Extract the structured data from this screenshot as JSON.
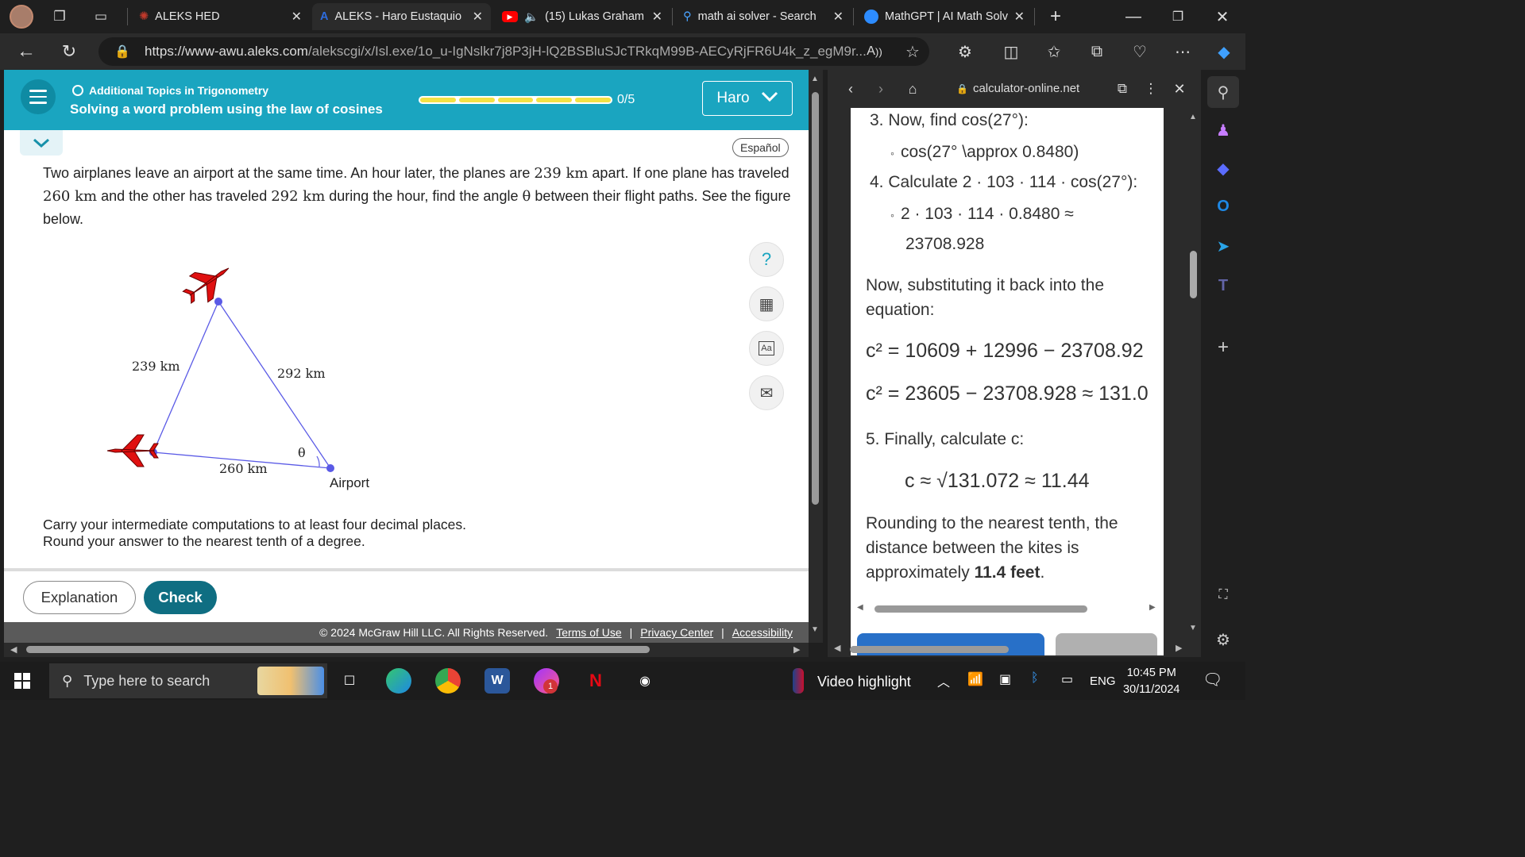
{
  "browser": {
    "tabs": [
      {
        "title": "ALEKS HED",
        "active": false
      },
      {
        "title": "ALEKS - Haro Eustaquio",
        "active": true
      },
      {
        "title": "(15) Lukas Graham",
        "active": false
      },
      {
        "title": "math ai solver - Search",
        "active": false
      },
      {
        "title": "MathGPT | AI Math Solv",
        "active": false
      }
    ],
    "url_host": "https://www-awu.aleks.com",
    "url_path": "/alekscgi/x/Isl.exe/1o_u-IgNslkr7j8P3jH-lQ2BSBluSJcTRkqM99B-AECyRjFR6U4k_z_egM9r..."
  },
  "aleks": {
    "topic": "Additional Topics in Trigonometry",
    "lesson": "Solving a word problem using the law of cosines",
    "progress": "0/5",
    "progress_fraction": 0.0,
    "user": "Haro",
    "espanol": "Español",
    "problem": {
      "p1": "Two airplanes leave an airport at the same time. An hour later, the planes are ",
      "d1": "239 km",
      "p2": " apart. If one plane has traveled\n",
      "d2": "260 km",
      "p3": " and the other has traveled ",
      "d3": "292 km",
      "p4": " during the hour, find the angle ",
      "theta": "θ",
      "p5": " between their flight paths. See the figure\nbelow."
    },
    "diagram": {
      "label_left": "239 km",
      "label_right": "292 km",
      "label_bottom": "260 km",
      "label_angle": "θ",
      "label_airport": "Airport"
    },
    "instructions": "Carry your intermediate computations to at least four decimal places.\nRound your answer to the nearest tenth of a degree.",
    "explanation_btn": "Explanation",
    "check_btn": "Check",
    "footer": {
      "copyright": "© 2024 McGraw Hill LLC. All Rights Reserved.",
      "terms": "Terms of Use",
      "privacy": "Privacy Center",
      "accessibility": "Accessibility"
    }
  },
  "sidepanel": {
    "site": "calculator-online.net",
    "step3": "3. Now, find cos(27°):",
    "step3_bullet": "cos(27° \\approx 0.8480)",
    "step4": "4. Calculate 2 · 103 · 114 · cos(27°):",
    "step4_bullet1": "2 · 103 · 114 · 0.8480 ≈",
    "step4_bullet2": "23708.928",
    "now_sub_1": "Now, substituting it back into the",
    "now_sub_2": "equation:",
    "eq1": "c² = 10609 + 12996 − 23708.92",
    "eq2": "c² = 23605 − 23708.928 ≈ 131.0",
    "step5": "5. Finally, calculate c:",
    "eq3": "c ≈ √131.072 ≈ 11.44",
    "round_1": "Rounding to the nearest tenth, the",
    "round_2": "distance between the kites is",
    "round_3a": "approximately ",
    "round_3b": "11.4 feet",
    "round_3c": "."
  },
  "taskbar": {
    "search_placeholder": "Type here to search",
    "video_highlight": "Video highlight",
    "lang": "ENG",
    "time": "10:45 PM",
    "date": "30/11/2024",
    "badge": "1"
  },
  "colors": {
    "aleks_header": "#1aa5c0",
    "check_button": "#0f6e82",
    "plane": "#e01010",
    "triangle": "#5a5ae6"
  }
}
